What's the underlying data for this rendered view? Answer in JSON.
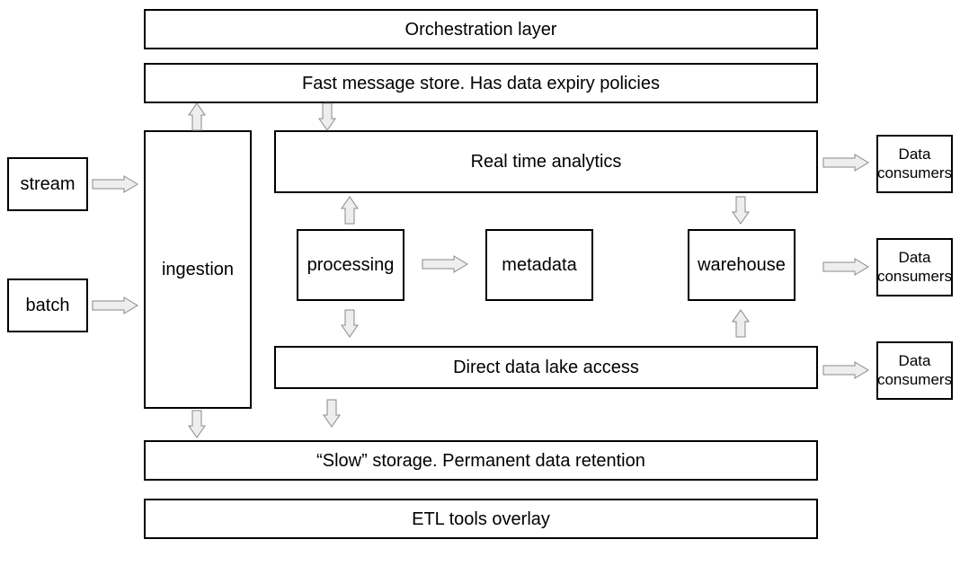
{
  "boxes": {
    "orchestration": "Orchestration layer",
    "fast_store": "Fast message store. Has data expiry policies",
    "stream": "stream",
    "batch": "batch",
    "ingestion": "ingestion",
    "realtime": "Real time analytics",
    "processing": "processing",
    "metadata": "metadata",
    "warehouse": "warehouse",
    "lake": "Direct data lake access",
    "slow_storage": "“Slow” storage. Permanent data retention",
    "etl": "ETL tools overlay",
    "consumer": "Data consumers"
  }
}
